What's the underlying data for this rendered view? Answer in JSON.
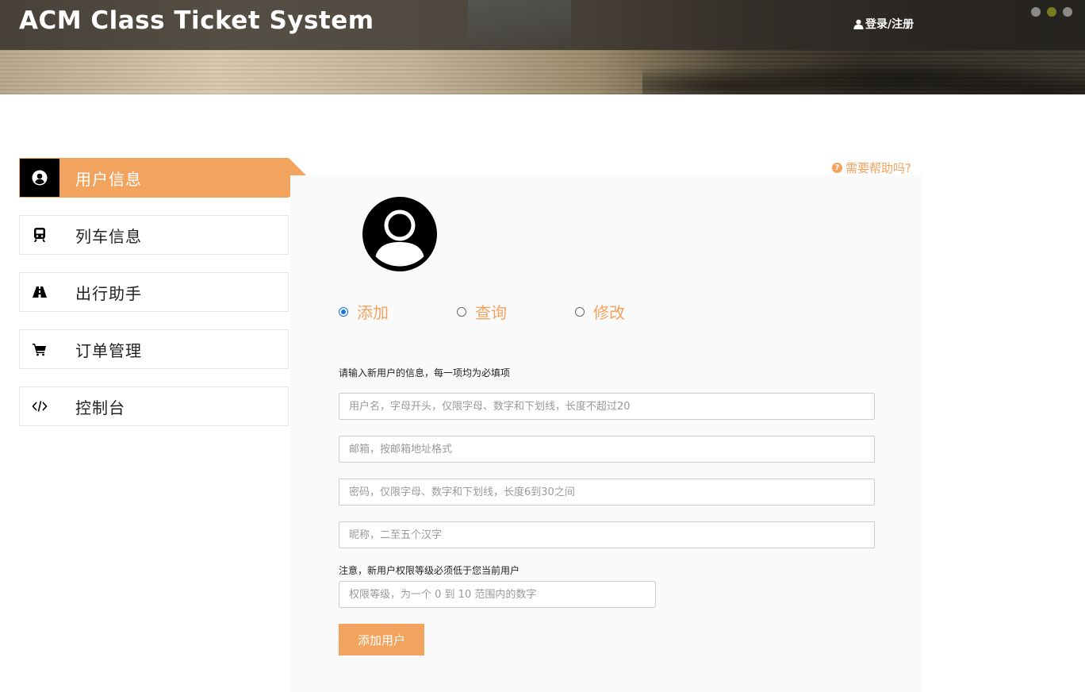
{
  "header": {
    "title": "ACM Class Ticket System",
    "login_label": "登录/注册",
    "window_dots": [
      "#888888",
      "#7a7a1e",
      "#888888"
    ]
  },
  "sidebar": {
    "items": [
      {
        "label": "用户信息",
        "icon": "user-circle-icon",
        "active": true
      },
      {
        "label": "列车信息",
        "icon": "train-icon",
        "active": false
      },
      {
        "label": "出行助手",
        "icon": "road-icon",
        "active": false
      },
      {
        "label": "订单管理",
        "icon": "cart-icon",
        "active": false
      },
      {
        "label": "控制台",
        "icon": "code-icon",
        "active": false
      }
    ]
  },
  "main": {
    "help_text": "需要帮助吗?",
    "mode_options": [
      {
        "label": "添加",
        "checked": true
      },
      {
        "label": "查询",
        "checked": false
      },
      {
        "label": "修改",
        "checked": false
      }
    ],
    "form_hint": "请输入新用户的信息，每一项均为必填项",
    "fields": {
      "username_placeholder": "用户名，字母开头，仅限字母、数字和下划线，长度不超过20",
      "email_placeholder": "邮箱，按邮箱地址格式",
      "password_placeholder": "密码，仅限字母、数字和下划线，长度6到30之间",
      "nickname_placeholder": "昵称，二至五个汉字",
      "privilege_placeholder": "权限等级，为一个 0 到 10 范围内的数字"
    },
    "privilege_note": "注意，新用户权限等级必须低于您当前用户",
    "submit_label": "添加用户"
  },
  "colors": {
    "accent": "#f2a35e",
    "radio_checked": "#1a73e8"
  }
}
